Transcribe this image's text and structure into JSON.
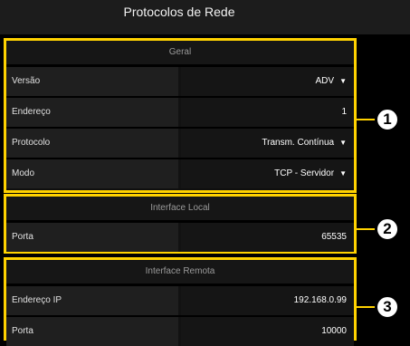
{
  "header": {
    "title": "Protocolos de Rede"
  },
  "sections": [
    {
      "title": "Geral",
      "rows": [
        {
          "label": "Versão",
          "value": "ADV",
          "dropdown": true
        },
        {
          "label": "Endereço",
          "value": "1",
          "dropdown": false
        },
        {
          "label": "Protocolo",
          "value": "Transm. Contínua",
          "dropdown": true
        },
        {
          "label": "Modo",
          "value": "TCP - Servidor",
          "dropdown": true
        }
      ]
    },
    {
      "title": "Interface Local",
      "rows": [
        {
          "label": "Porta",
          "value": "65535",
          "dropdown": false
        }
      ]
    },
    {
      "title": "Interface Remota",
      "rows": [
        {
          "label": "Endereço IP",
          "value": "192.168.0.99",
          "dropdown": false
        },
        {
          "label": "Porta",
          "value": "10000",
          "dropdown": false
        }
      ]
    }
  ],
  "callouts": [
    "1",
    "2",
    "3"
  ],
  "colors": {
    "highlight": "#ffd200",
    "background": "#000000",
    "row_label_bg": "#1f1f1f"
  },
  "icons": {
    "dropdown": "caret-down-icon"
  }
}
